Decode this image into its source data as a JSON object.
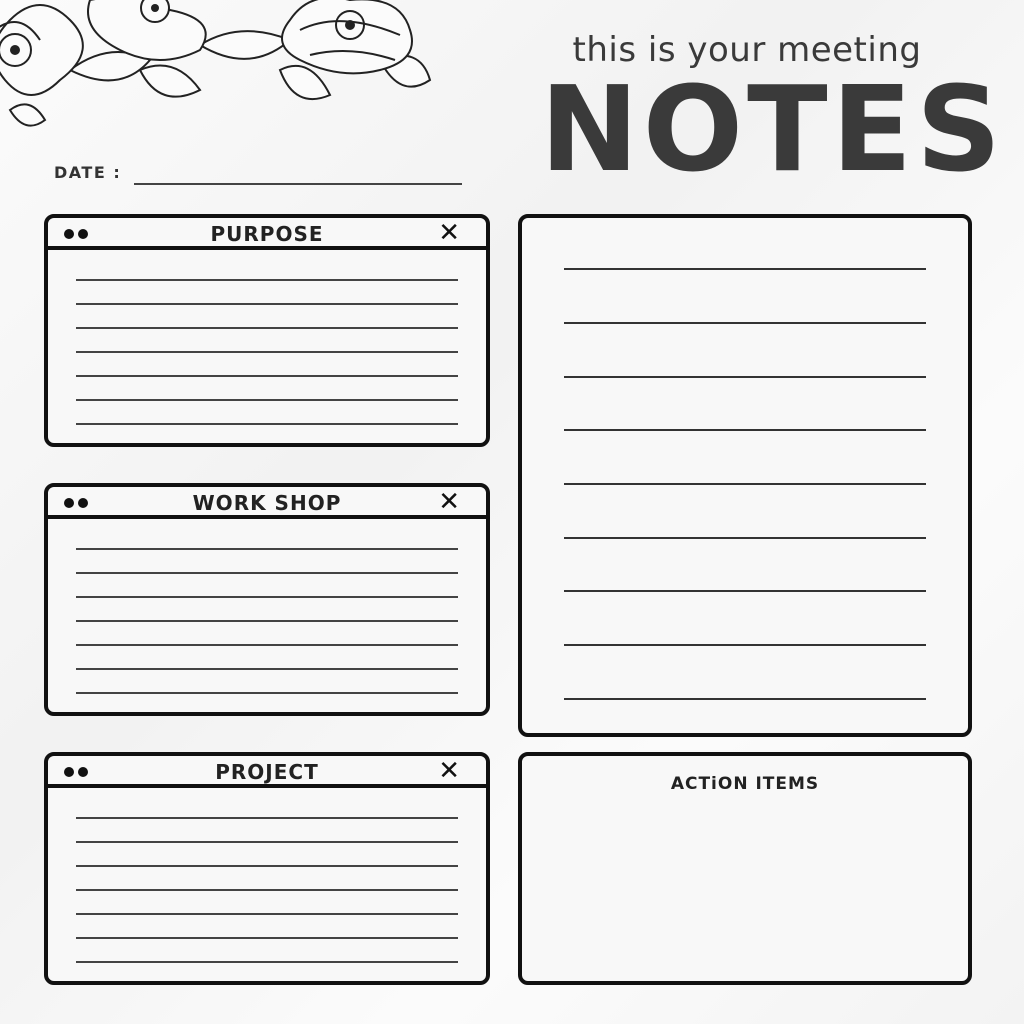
{
  "header": {
    "subtitle": "this is your meeting",
    "title": "NOTES"
  },
  "date": {
    "label": "DATE :",
    "value": ""
  },
  "sections": [
    {
      "title": "PURPOSE"
    },
    {
      "title": "WORK SHOP"
    },
    {
      "title": "PROJECT"
    }
  ],
  "action_items": {
    "title": "ACTiON ITEMS"
  },
  "icons": {
    "window_dots": "window-dots-icon",
    "close": "close-icon",
    "close_glyph": "✕",
    "decoration": "floral-icon"
  },
  "colors": {
    "ink": "#111111",
    "text": "#3a3a3a",
    "paper": "#f6f6f6"
  }
}
